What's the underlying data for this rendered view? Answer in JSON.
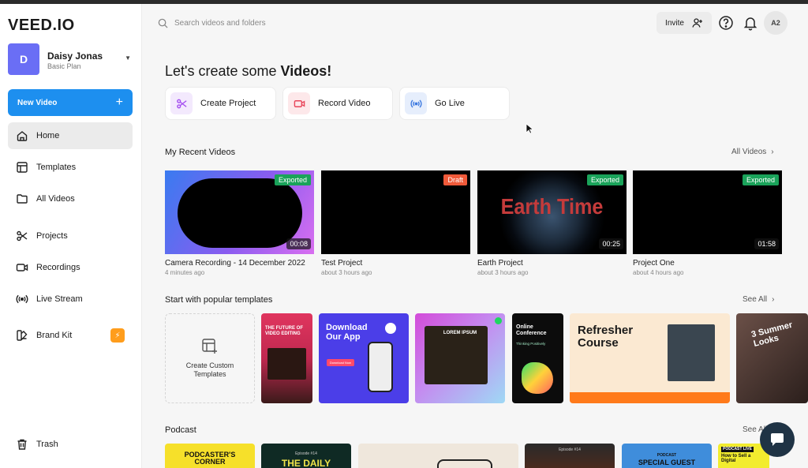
{
  "app": {
    "logo": "VEED.IO"
  },
  "account": {
    "initial": "D",
    "name": "Daisy Jonas",
    "plan": "Basic Plan"
  },
  "sidebar": {
    "new_video": "New Video",
    "items": [
      {
        "label": "Home",
        "icon": "home-icon",
        "active": true
      },
      {
        "label": "Templates",
        "icon": "templates-icon"
      },
      {
        "label": "All Videos",
        "icon": "folder-icon"
      },
      {
        "label": "Projects",
        "icon": "scissors-icon"
      },
      {
        "label": "Recordings",
        "icon": "camera-icon"
      },
      {
        "label": "Live Stream",
        "icon": "broadcast-icon"
      },
      {
        "label": "Brand Kit",
        "icon": "brand-kit-icon"
      },
      {
        "label": "Trash",
        "icon": "trash-icon"
      }
    ]
  },
  "header": {
    "search_placeholder": "Search videos and folders",
    "invite": "Invite",
    "user_initials": "A2"
  },
  "main": {
    "heading_prefix": "Let's create some ",
    "heading_bold": "Videos!",
    "quick_actions": [
      {
        "label": "Create Project",
        "icon": "scissors-icon",
        "color": "#a44ef0",
        "bg": "#f3e9fd"
      },
      {
        "label": "Record Video",
        "icon": "camera-icon",
        "color": "#e8455a",
        "bg": "#fde8ea"
      },
      {
        "label": "Go Live",
        "icon": "broadcast-icon",
        "color": "#3f7be0",
        "bg": "#e6eefc"
      }
    ],
    "recent": {
      "title": "My Recent Videos",
      "see_all": "All Videos",
      "videos": [
        {
          "title": "Camera Recording - 14 December 2022",
          "time": "4 minutes ago",
          "status": "Exported",
          "duration": "00:08"
        },
        {
          "title": "Test Project",
          "time": "about 3 hours ago",
          "status": "Draft",
          "duration": ""
        },
        {
          "title": "Earth Project",
          "time": "about 3 hours ago",
          "status": "Exported",
          "duration": "00:25",
          "overlay": "Earth Time"
        },
        {
          "title": "Project One",
          "time": "about 4 hours ago",
          "status": "Exported",
          "duration": "01:58"
        }
      ]
    },
    "templates": {
      "title": "Start with popular templates",
      "see_all": "See All",
      "create_custom": "Create Custom Templates",
      "cards": [
        {
          "text": "THE FUTURE OF VIDEO EDITING"
        },
        {
          "text": "Download Our App",
          "sub": "Download Now"
        },
        {
          "text": "LOREM IPSUM"
        },
        {
          "text": "Online Conference",
          "sub": "Thinking Positively"
        },
        {
          "text": "Refresher Course"
        },
        {
          "text": "3 Summer Looks"
        }
      ]
    },
    "podcast": {
      "title": "Podcast",
      "see_all": "See All",
      "cards": [
        {
          "text": "PODCASTER'S CORNER"
        },
        {
          "text": "THE DAILY",
          "sub": "Episode #14"
        },
        {
          "text": ""
        },
        {
          "text": "",
          "sub": "Episode #14"
        },
        {
          "text": "SPECIAL GUEST",
          "sub": "PODCAST"
        },
        {
          "text": "How to Sell a Digital",
          "sub": "PODCAST LIVE"
        }
      ]
    }
  },
  "colors": {
    "accent": "#1d8fef",
    "exported": "#1aa35a",
    "draft": "#f05a3a",
    "brand_kit_badge": "#ff9d1c"
  }
}
